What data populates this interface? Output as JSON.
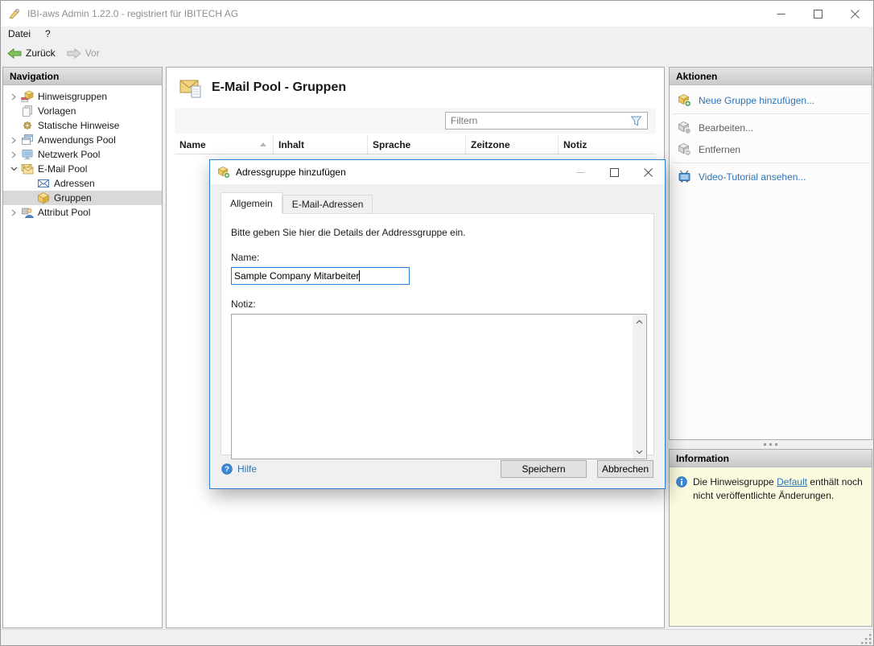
{
  "window": {
    "title": "IBI-aws Admin 1.22.0 - registriert für IBITECH AG"
  },
  "menu": {
    "items": [
      {
        "label": "Datei"
      },
      {
        "label": "?"
      }
    ]
  },
  "toolbar": {
    "back_label": "Zurück",
    "forward_label": "Vor"
  },
  "navigation": {
    "header": "Navigation",
    "items": [
      {
        "label": "Hinweisgruppen",
        "chevron": "right",
        "level": 0,
        "selected": false
      },
      {
        "label": "Vorlagen",
        "chevron": "none",
        "level": 0,
        "selected": false
      },
      {
        "label": "Statische Hinweise",
        "chevron": "none",
        "level": 0,
        "selected": false
      },
      {
        "label": "Anwendungs Pool",
        "chevron": "right",
        "level": 0,
        "selected": false
      },
      {
        "label": "Netzwerk Pool",
        "chevron": "right",
        "level": 0,
        "selected": false
      },
      {
        "label": "E-Mail Pool",
        "chevron": "down",
        "level": 0,
        "selected": false
      },
      {
        "label": "Adressen",
        "chevron": "none",
        "level": 1,
        "selected": false
      },
      {
        "label": "Gruppen",
        "chevron": "none",
        "level": 1,
        "selected": true
      },
      {
        "label": "Attribut Pool",
        "chevron": "right",
        "level": 0,
        "selected": false
      }
    ]
  },
  "main": {
    "title": "E-Mail Pool - Gruppen",
    "filter": {
      "placeholder": "Filtern"
    },
    "table": {
      "columns": [
        "Name",
        "Inhalt",
        "Sprache",
        "Zeitzone",
        "Notiz"
      ],
      "sorted_column": "Name",
      "sort_direction": "asc",
      "rows": []
    }
  },
  "dialog": {
    "title": "Adressgruppe hinzufügen",
    "tabs": [
      {
        "label": "Allgemein",
        "active": true
      },
      {
        "label": "E-Mail-Adressen",
        "active": false
      }
    ],
    "intro": "Bitte geben Sie hier die Details der Addressgruppe ein.",
    "name_label": "Name:",
    "name_value": "Sample Company Mitarbeiter",
    "notiz_label": "Notiz:",
    "notiz_value": "",
    "help_label": "Hilfe",
    "save_label": "Speichern",
    "cancel_label": "Abbrechen"
  },
  "actions": {
    "header": "Aktionen",
    "items": [
      {
        "label": "Neue Gruppe hinzufügen...",
        "enabled": true
      },
      {
        "label": "Bearbeiten...",
        "enabled": false
      },
      {
        "label": "Entfernen",
        "enabled": false
      },
      {
        "label": "Video-Tutorial ansehen...",
        "enabled": true
      }
    ]
  },
  "information": {
    "header": "Information",
    "text_before": "Die Hinweisgruppe ",
    "link_text": "Default",
    "text_after": " enthält noch nicht veröffentlichte Änderungen."
  },
  "colors": {
    "link_blue": "#2E74B5",
    "dialog_border": "#2B7CD3",
    "info_panel_bg": "#FBFBDF",
    "tree_selection_bg": "#D9D9D9",
    "back_arrow_green": "#82C35C",
    "panel_header_gradient": "#E4E4E4-#CACACA"
  }
}
